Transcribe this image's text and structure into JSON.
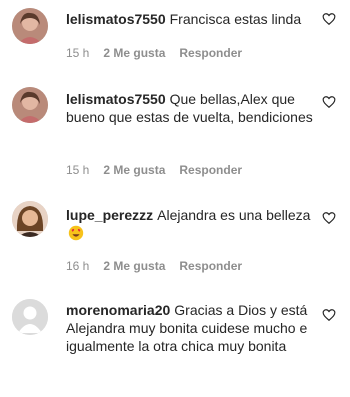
{
  "comments": [
    {
      "username": "lelismatos7550",
      "text": "Francisca estas linda",
      "time": "15 h",
      "likes": "2 Me gusta",
      "reply": "Responder",
      "avatar": "photo-avatar-woman-pink"
    },
    {
      "username": "lelismatos7550",
      "text": "Que bellas,Alex que bueno que estas de vuelta, bendiciones",
      "time": "15 h",
      "likes": "2 Me gusta",
      "reply": "Responder",
      "avatar": "photo-avatar-woman-pink"
    },
    {
      "username": "lupe_perezzz",
      "text": "Alejandra es una belleza",
      "emoji": "heart-eyes-emoji",
      "time": "16 h",
      "likes": "2 Me gusta",
      "reply": "Responder",
      "avatar": "photo-avatar-woman-brown"
    },
    {
      "username": "morenomaria20",
      "text": "Gracias a Dios y está Alejandra muy bonita cuidese mucho e igualmente la otra chica muy bonita",
      "avatar": "default-avatar"
    }
  ],
  "icons": {
    "like": "heart-outline-icon"
  },
  "colors": {
    "text": "#262626",
    "meta": "#8e8e8e",
    "background": "#ffffff"
  }
}
